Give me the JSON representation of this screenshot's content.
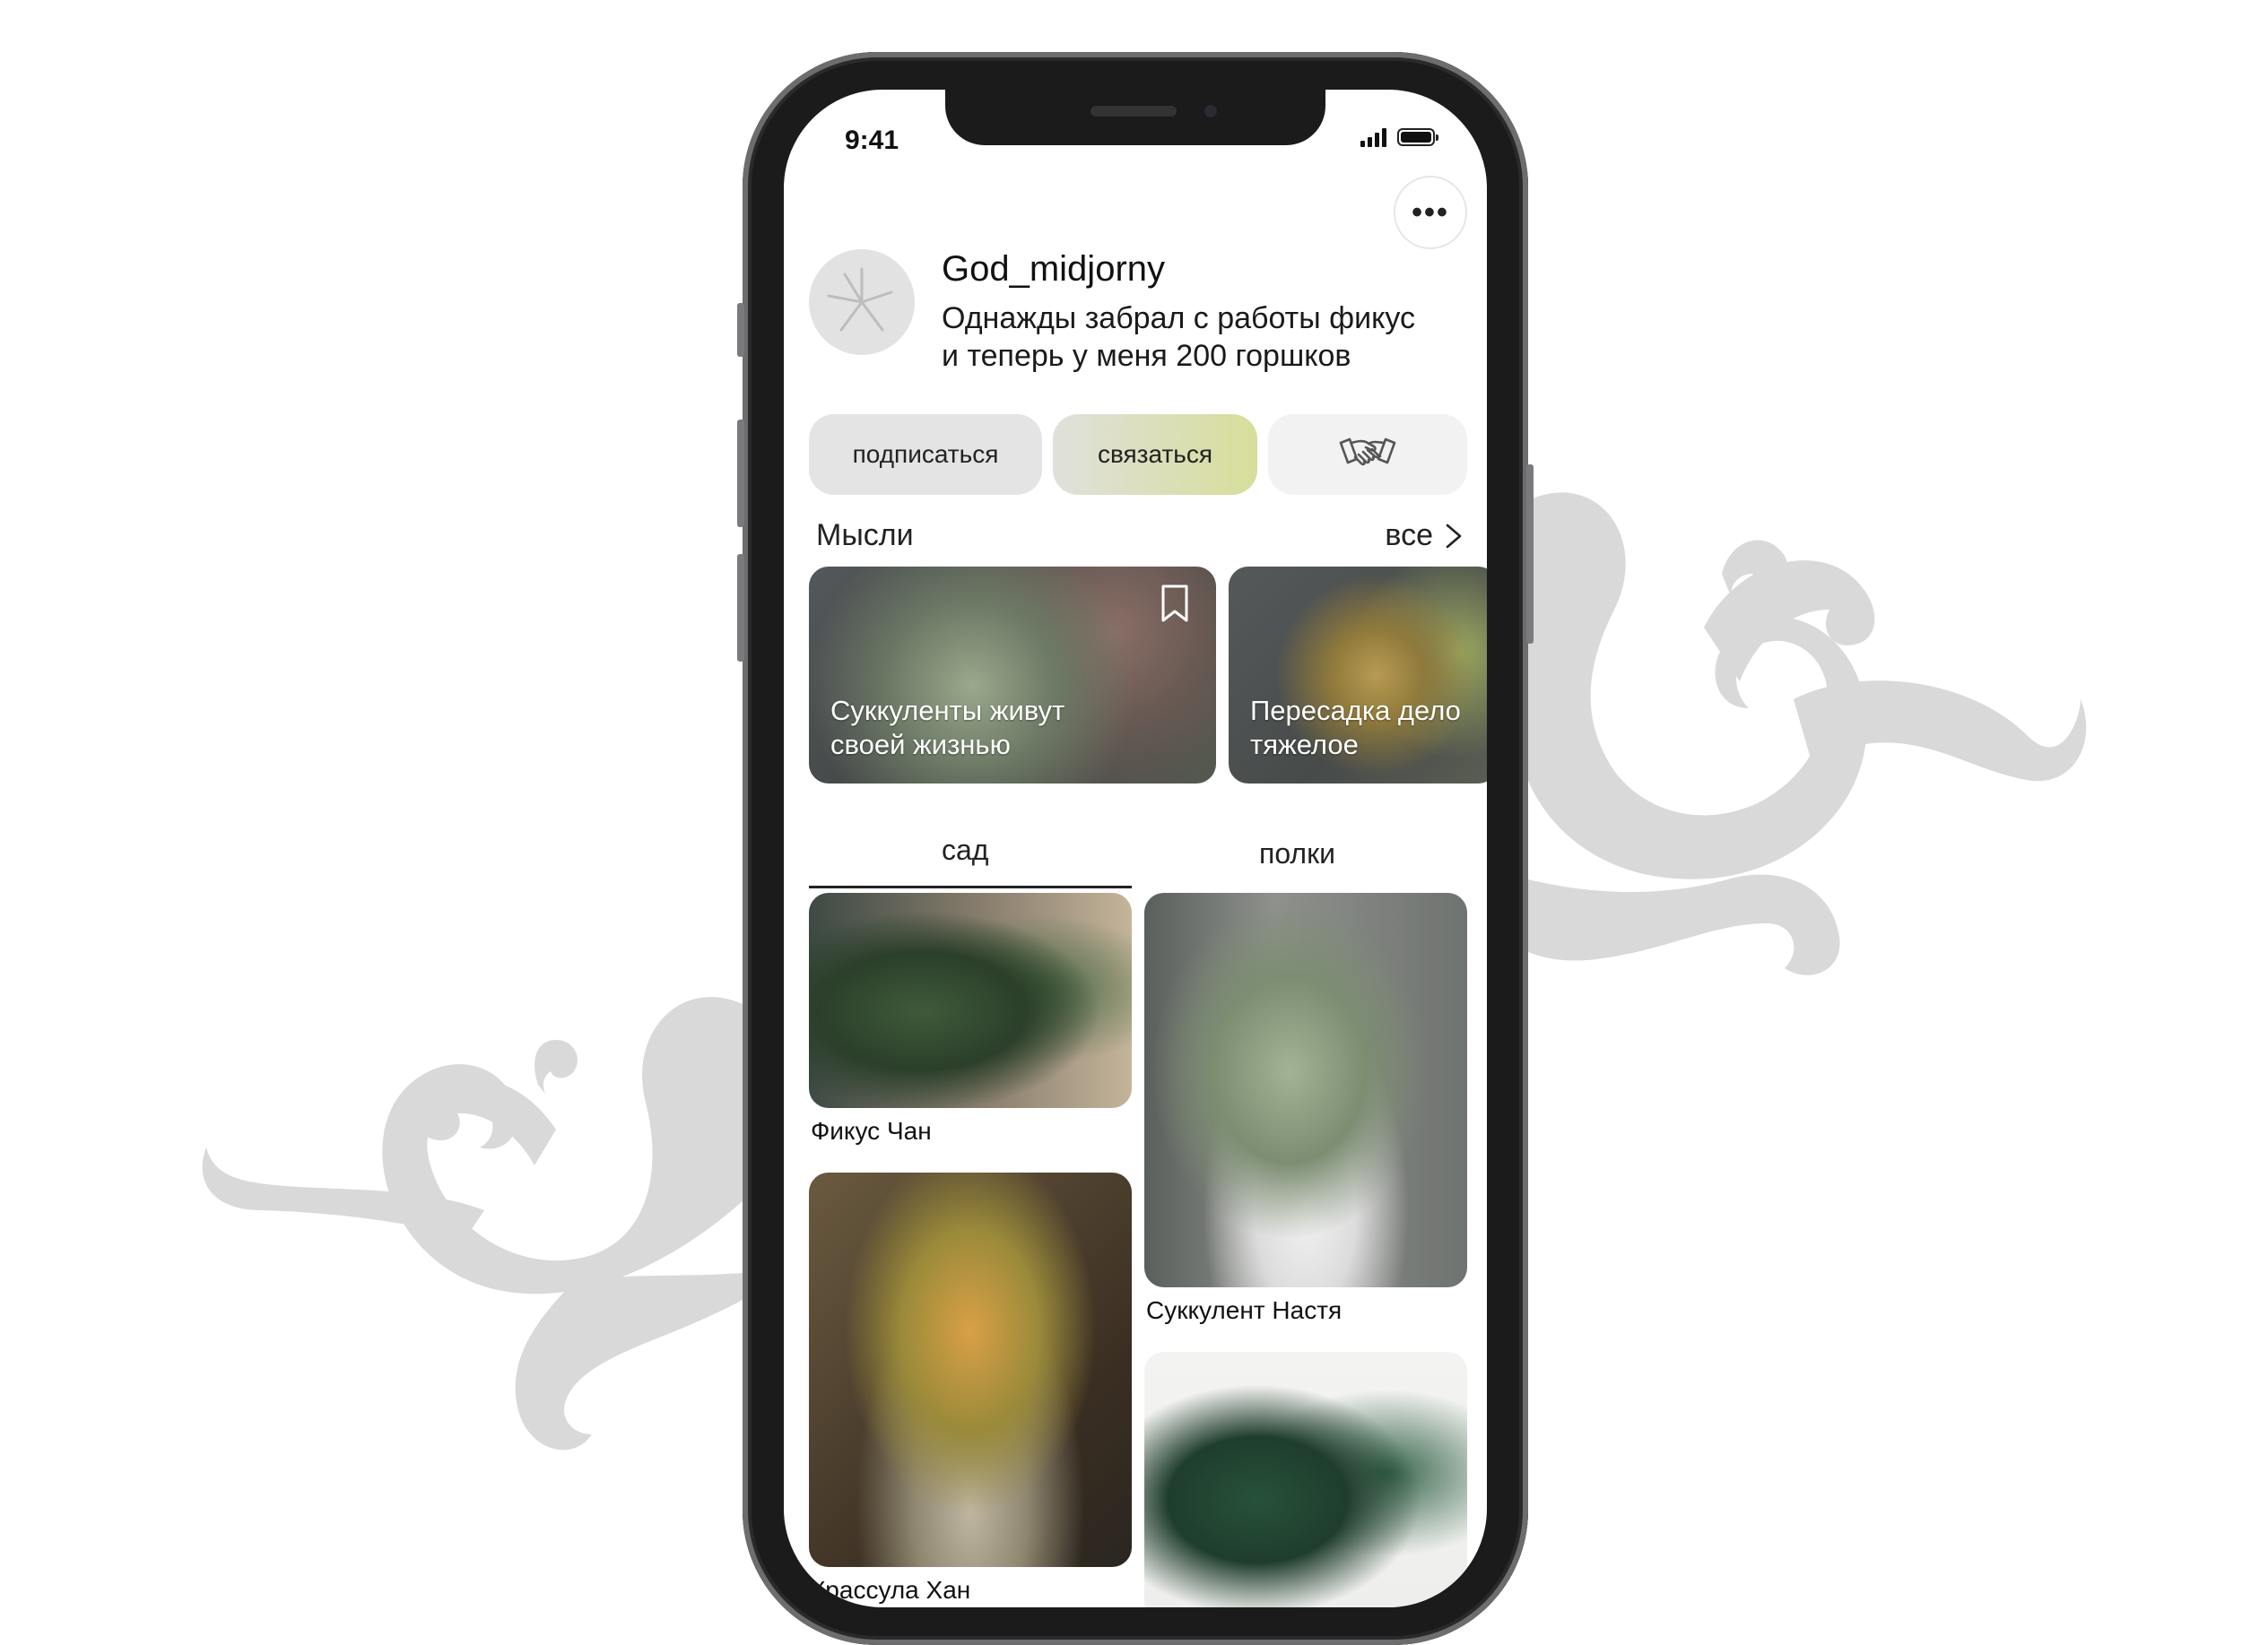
{
  "status_bar": {
    "time": "9:41"
  },
  "profile": {
    "username": "God_midjorny",
    "bio": "Однажды забрал с работы фикус\nи теперь у меня 200 горшков",
    "more_label": "•••"
  },
  "actions": {
    "subscribe_label": "подписаться",
    "contact_label": "связаться",
    "deal_icon": "handshake-icon"
  },
  "thoughts": {
    "title": "Мысли",
    "see_all": "все",
    "items": [
      {
        "text": "Суккуленты живут\nсвоей жизнью"
      },
      {
        "text": "Пересадка дело\nтяжелое"
      }
    ]
  },
  "tabs": [
    {
      "label": "сад",
      "active": true
    },
    {
      "label": "полки",
      "active": false
    }
  ],
  "garden": [
    {
      "name": "Фикус Чан"
    },
    {
      "name": "Суккулент Настя"
    },
    {
      "name": "Крассула Хан"
    },
    {
      "name": ""
    }
  ],
  "colors": {
    "accent_gradient_end": "#d7de9a",
    "button_bg": "#e4e4e4",
    "ornament": "#d6d6d6"
  }
}
